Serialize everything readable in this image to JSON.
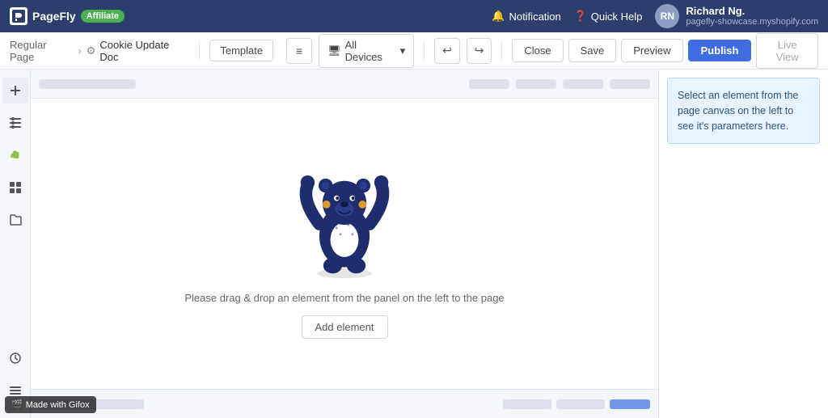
{
  "topnav": {
    "logo_text": "PageFly",
    "affiliate_label": "Affiliate",
    "notification_label": "Notification",
    "quick_help_label": "Quick Help",
    "user_name": "Richard Ng.",
    "user_store": "pagefly-showcase.myshopify.com",
    "user_initials": "RN"
  },
  "toolbar": {
    "breadcrumb_parent": "Regular Page",
    "breadcrumb_current": "Cookie Update Doc",
    "template_label": "Template",
    "device_label": "All Devices",
    "close_label": "Close",
    "save_label": "Save",
    "preview_label": "Preview",
    "publish_label": "Publish",
    "live_view_label": "Live View"
  },
  "canvas": {
    "empty_text": "Please drag & drop an element from the panel on the left to the page",
    "add_element_label": "Add element"
  },
  "right_panel": {
    "info_text": "Select an element from the page canvas on the left to see it's parameters here."
  },
  "gifox": {
    "label": "Made with Gifox"
  },
  "sidebar": {
    "items": [
      {
        "name": "add-icon",
        "symbol": "＋"
      },
      {
        "name": "grid-icon",
        "symbol": "⊞"
      },
      {
        "name": "shopify-icon",
        "symbol": "S"
      },
      {
        "name": "apps-icon",
        "symbol": "⬛"
      },
      {
        "name": "folder-icon",
        "symbol": "📁"
      }
    ],
    "bottom_items": [
      {
        "name": "history-icon",
        "symbol": "🕐"
      },
      {
        "name": "list-icon",
        "symbol": "☰"
      }
    ]
  }
}
